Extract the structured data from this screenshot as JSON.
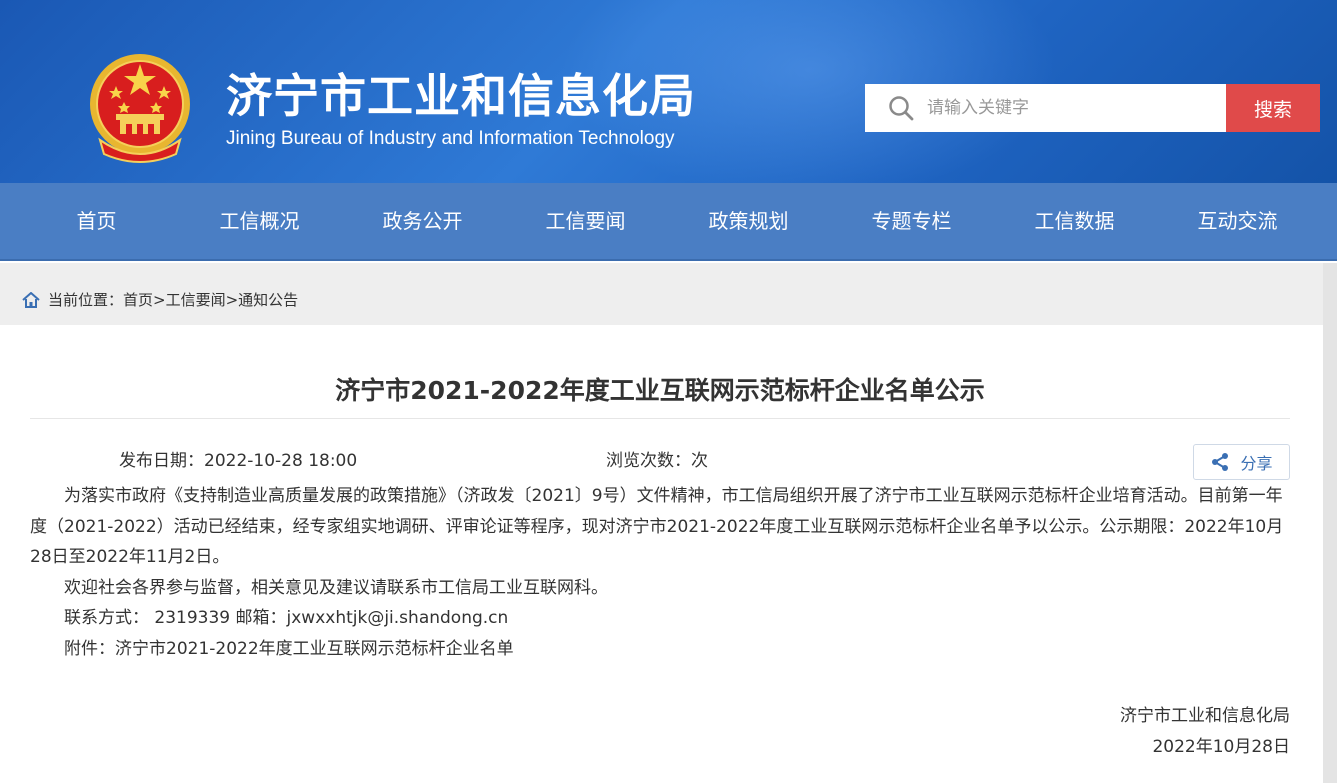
{
  "header": {
    "title": "济宁市工业和信息化局",
    "subtitle": "Jining Bureau of Industry and Information Technology",
    "search_placeholder": "请输入关键字",
    "search_button": "搜索"
  },
  "nav": {
    "items": [
      "首页",
      "工信概况",
      "政务公开",
      "工信要闻",
      "政策规划",
      "专题专栏",
      "工信数据",
      "互动交流"
    ]
  },
  "breadcrumb": {
    "prefix": "当前位置：",
    "path": "首页>工信要闻>通知公告"
  },
  "article": {
    "title": "济宁市2021-2022年度工业互联网示范标杆企业名单公示",
    "date_label": "发布日期：",
    "date": "2022-10-28 18:00",
    "views_label": "浏览次数：次",
    "share_label": "分享",
    "paragraphs": [
      "为落实市政府《支持制造业高质量发展的政策措施》（济政发〔2021〕9号）文件精神，市工信局组织开展了济宁市工业互联网示范标杆企业培育活动。目前第一年度（2021-2022）活动已经结束，经专家组实地调研、评审论证等程序，现对济宁市2021-2022年度工业互联网示范标杆企业名单予以公示。公示期限：2022年10月28日至2022年11月2日。",
      "欢迎社会各界参与监督，相关意见及建议请联系市工信局工业互联网科。",
      "联系方式：  2319339  邮箱：jxwxxhtjk@ji.shandong.cn",
      "附件：济宁市2021-2022年度工业互联网示范标杆企业名单"
    ],
    "sign_org": "济宁市工业和信息化局",
    "sign_date": "2022年10月28日"
  },
  "colors": {
    "header_blue": "#1f64c2",
    "nav_blue": "#4a7ec4",
    "search_red": "#e04a4a",
    "share_blue": "#3a6fb3"
  }
}
